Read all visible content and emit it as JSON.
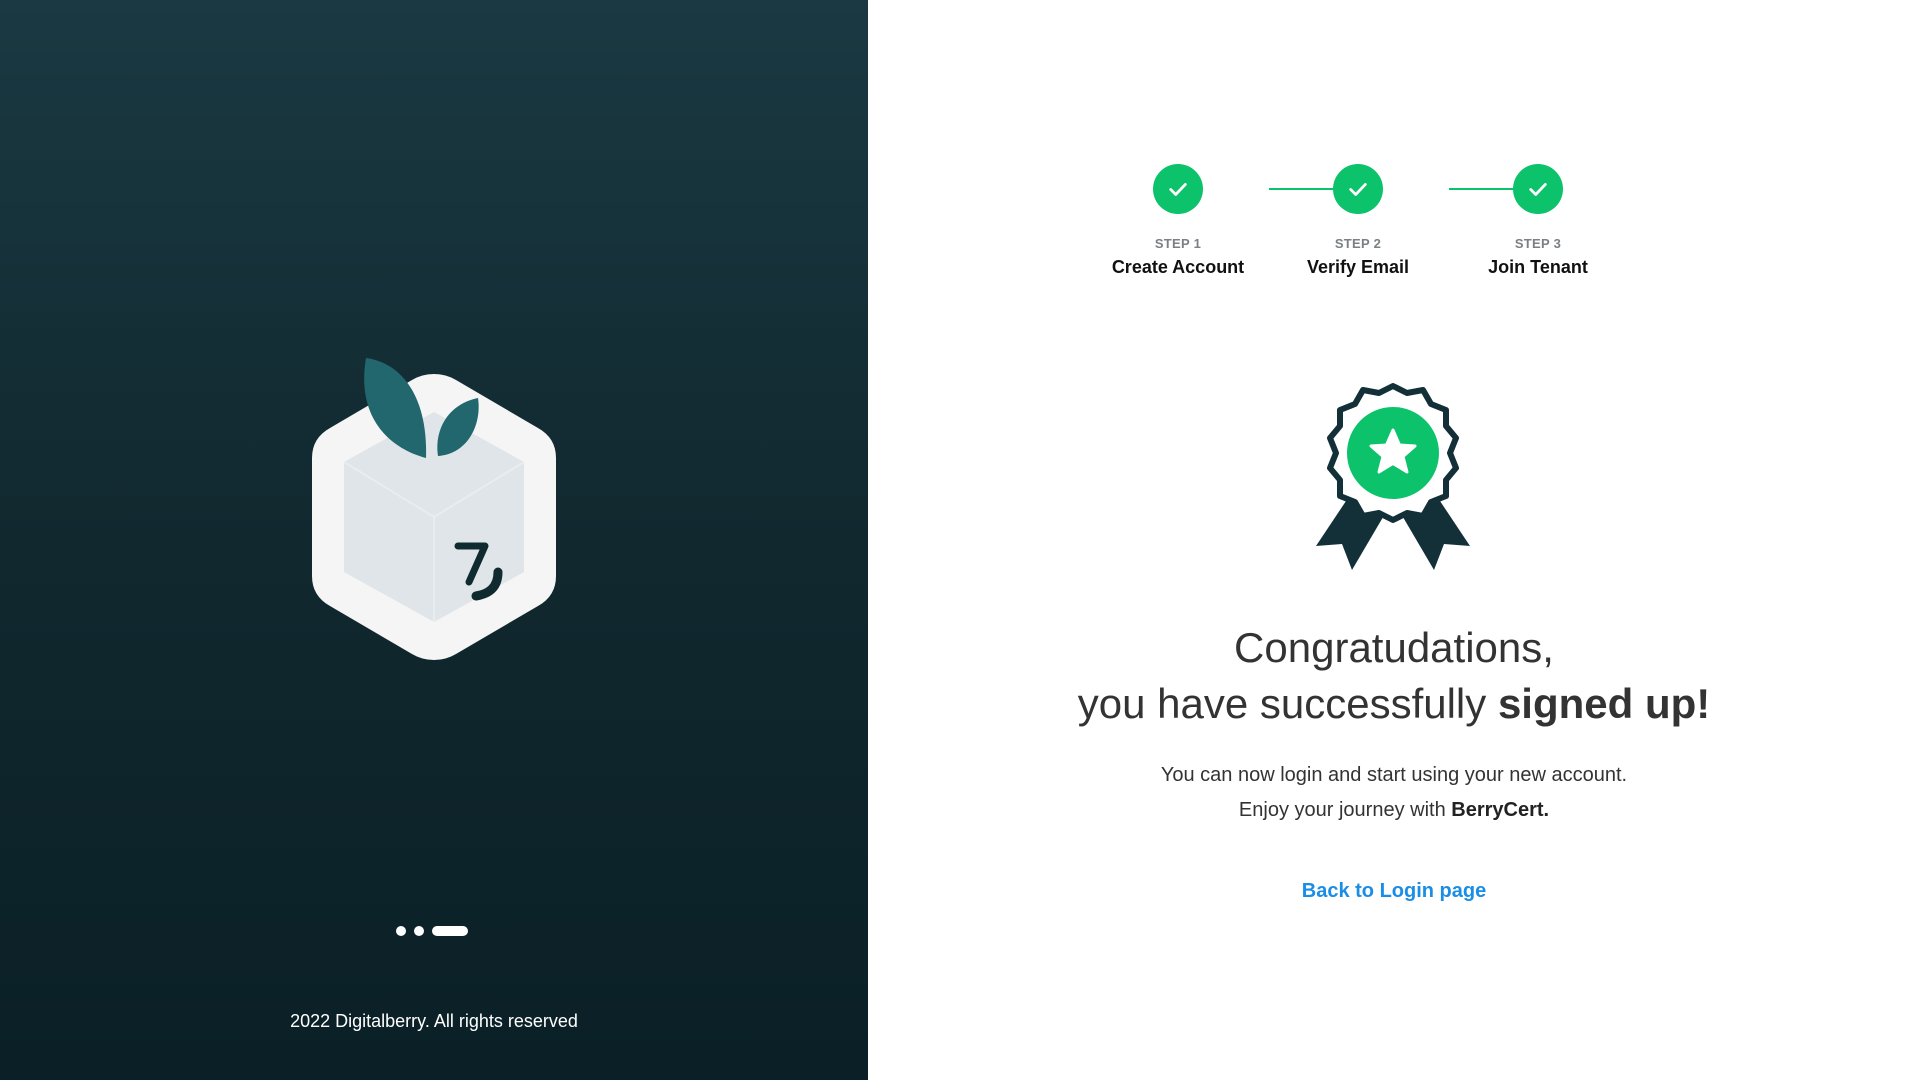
{
  "left": {
    "footer": "2022 Digitalberry. All rights reserved",
    "carousel": {
      "count": 3,
      "active_index": 2
    }
  },
  "stepper": {
    "steps": [
      {
        "number": "STEP 1",
        "label": "Create Account",
        "status": "completed"
      },
      {
        "number": "STEP 2",
        "label": "Verify Email",
        "status": "completed"
      },
      {
        "number": "STEP 3",
        "label": "Join Tenant",
        "status": "completed"
      }
    ]
  },
  "success": {
    "title_line1": "Congratudations,",
    "title_line2_regular": "you have successfully ",
    "title_line2_bold": "signed up!",
    "message_line1": "You can now login and start using your new account.",
    "message_line2_regular": "Enjoy your journey with ",
    "message_line2_bold": "BerryCert.",
    "back_link": "Back to Login page"
  },
  "icons": {
    "logo": "berry-cube-logo",
    "step": "check-icon",
    "badge": "award-ribbon-star-icon"
  },
  "colors": {
    "accent_green": "#0cc26b",
    "panel_dark": "#11282f",
    "leaf_teal": "#22666e",
    "link_blue": "#1a8ee6"
  }
}
